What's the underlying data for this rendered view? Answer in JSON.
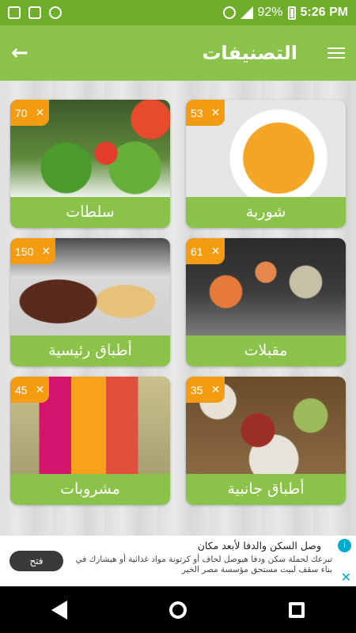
{
  "status_bar": {
    "battery_percent": "92%",
    "time": "5:26 PM"
  },
  "app_bar": {
    "title": "التصنيفات"
  },
  "categories": [
    {
      "label": "شوربة",
      "count": "53",
      "image": "soup"
    },
    {
      "label": "سلطات",
      "count": "70",
      "image": "salad"
    },
    {
      "label": "مقبلات",
      "count": "61",
      "image": "appetizers"
    },
    {
      "label": "أطباق رئيسية",
      "count": "150",
      "image": "main-dishes"
    },
    {
      "label": "أطباق جانبية",
      "count": "35",
      "image": "side-dishes"
    },
    {
      "label": "مشروبات",
      "count": "45",
      "image": "drinks"
    }
  ],
  "ad": {
    "title": "وصل السكن والدفا لأبعد مكان",
    "body": "تبرعك لحملة سكن ودفا هيوصل لحاف أو كرتونة مواد غذائية أو هيشارك في بناء سقف لبيت مستحق مؤسسة مصر الخير",
    "button_label": "فتح",
    "info_icon": "i",
    "close_icon": "✕"
  },
  "colors": {
    "status_bar": "#6fae2a",
    "app_bar": "#8bc34a",
    "badge": "#f39c12",
    "card_label": "#8bc34a"
  }
}
